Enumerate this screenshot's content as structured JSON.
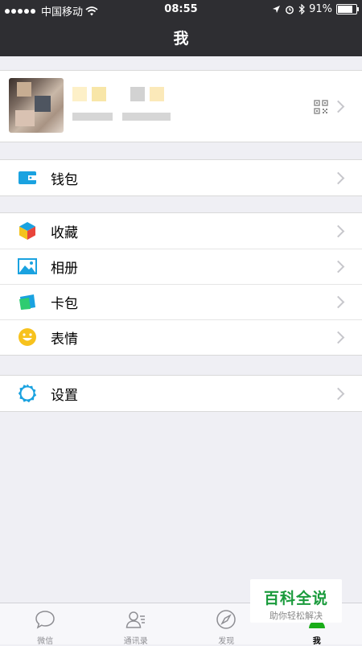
{
  "status": {
    "carrier": "中国移动",
    "time": "08:55",
    "battery": "91%",
    "battery_level": 0.91
  },
  "nav": {
    "title": "我"
  },
  "groups": {
    "wallet": [
      {
        "label": "钱包",
        "icon": "wallet-icon",
        "color": "#1aa2e0"
      }
    ],
    "media": [
      {
        "label": "收藏",
        "icon": "favorites-cube-icon"
      },
      {
        "label": "相册",
        "icon": "album-icon"
      },
      {
        "label": "卡包",
        "icon": "card-package-icon"
      },
      {
        "label": "表情",
        "icon": "sticker-smile-icon"
      }
    ],
    "settings": [
      {
        "label": "设置",
        "icon": "settings-gear-icon"
      }
    ]
  },
  "tabs": [
    {
      "label": "微信",
      "icon": "chat-bubble-icon"
    },
    {
      "label": "通讯录",
      "icon": "contacts-icon"
    },
    {
      "label": "发现",
      "icon": "compass-icon"
    },
    {
      "label": "我",
      "icon": "me-icon",
      "active": true
    }
  ],
  "watermark": {
    "title": "百科全说",
    "subtitle": "助你轻松解决"
  },
  "colors": {
    "accent": "#1aad19",
    "navbar": "#2e2e32",
    "background": "#efeff4"
  }
}
